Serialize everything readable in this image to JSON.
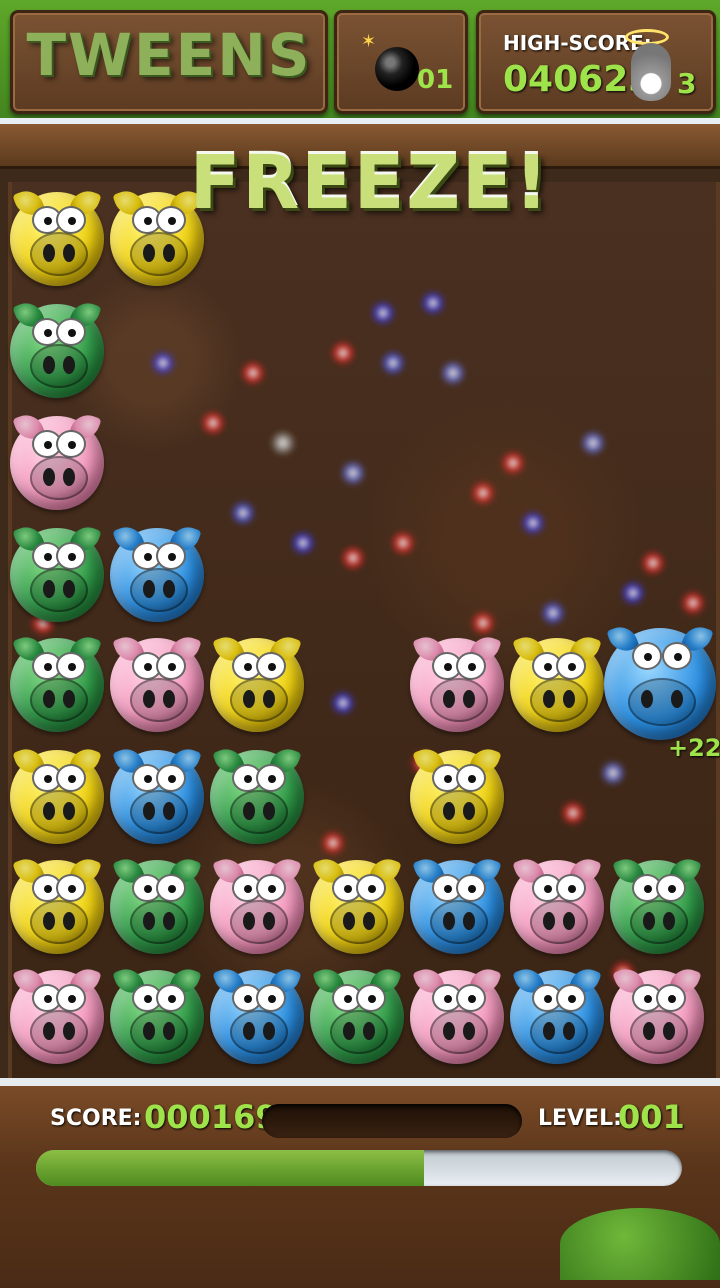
{
  "header": {
    "logo_text": "TWEENS",
    "bomb_count": "01",
    "high_score_label": "HIGH-SCORE:",
    "high_score_value": "040623",
    "lives": "3"
  },
  "banner": "FREEZE!",
  "bonus_popup": "+22",
  "hud": {
    "score_label": "SCORE:",
    "score_value": "000169",
    "level_label": "LEVEL:",
    "level_value": "001",
    "progress": 0.6
  },
  "colors": {
    "yellow": "#f1d312",
    "green": "#2f9a48",
    "pink": "#f59abf",
    "blue": "#2b8ee0",
    "score_green": "#9fe34a"
  },
  "grid": [
    {
      "row": 0,
      "col": 0,
      "color": "yellow"
    },
    {
      "row": 0,
      "col": 1,
      "color": "yellow"
    },
    {
      "row": 1,
      "col": 0,
      "color": "green"
    },
    {
      "row": 2,
      "col": 0,
      "color": "pink"
    },
    {
      "row": 3,
      "col": 0,
      "color": "green"
    },
    {
      "row": 3,
      "col": 1,
      "color": "blue"
    },
    {
      "row": 4,
      "col": 0,
      "color": "green"
    },
    {
      "row": 4,
      "col": 1,
      "color": "pink"
    },
    {
      "row": 4,
      "col": 2,
      "color": "yellow"
    },
    {
      "row": 4,
      "col": 4,
      "color": "pink"
    },
    {
      "row": 4,
      "col": 5,
      "color": "yellow"
    },
    {
      "row": 4,
      "col": 6,
      "color": "blue",
      "big": true
    },
    {
      "row": 5,
      "col": 0,
      "color": "yellow"
    },
    {
      "row": 5,
      "col": 1,
      "color": "blue"
    },
    {
      "row": 5,
      "col": 2,
      "color": "green"
    },
    {
      "row": 5,
      "col": 4,
      "color": "yellow"
    },
    {
      "row": 6,
      "col": 0,
      "color": "yellow"
    },
    {
      "row": 6,
      "col": 1,
      "color": "green"
    },
    {
      "row": 6,
      "col": 2,
      "color": "pink"
    },
    {
      "row": 6,
      "col": 3,
      "color": "yellow"
    },
    {
      "row": 6,
      "col": 4,
      "color": "blue"
    },
    {
      "row": 6,
      "col": 5,
      "color": "pink"
    },
    {
      "row": 6,
      "col": 6,
      "color": "green"
    },
    {
      "row": 7,
      "col": 0,
      "color": "pink"
    },
    {
      "row": 7,
      "col": 1,
      "color": "green"
    },
    {
      "row": 7,
      "col": 2,
      "color": "blue"
    },
    {
      "row": 7,
      "col": 3,
      "color": "green"
    },
    {
      "row": 7,
      "col": 4,
      "color": "pink"
    },
    {
      "row": 7,
      "col": 5,
      "color": "blue"
    },
    {
      "row": 7,
      "col": 6,
      "color": "pink"
    }
  ]
}
